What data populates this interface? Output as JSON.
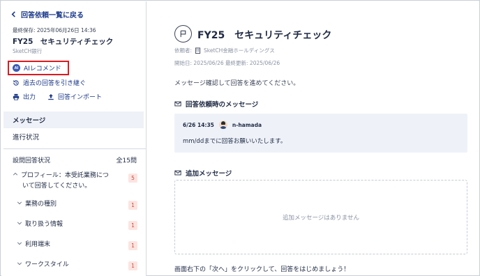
{
  "sidebar": {
    "back_label": "回答依頼一覧に戻る",
    "last_saved": "最終保存: 2025年06月26日 14:36",
    "title": "FY25　セキュリティチェック",
    "org": "SketCH銀行",
    "ai_recommend_label": "AIレコメンド",
    "ai_badge": "AI",
    "actions": {
      "inherit_label": "過去の回答を引き継ぐ",
      "export_label": "出力",
      "import_label": "回答インポート"
    },
    "nav": {
      "messages_label": "メッセージ",
      "progress_label": "進行状況"
    },
    "question_status": {
      "label": "設問回答状況",
      "total": "全15問"
    },
    "tree": [
      {
        "label_line1": "プロフィール：本受託業務につ",
        "label_line2": "いて回答してください。",
        "count": "5"
      },
      {
        "label": "業務の種別",
        "count": "1"
      },
      {
        "label": "取り扱う情報",
        "count": "1"
      },
      {
        "label": "利用端末",
        "count": "1"
      },
      {
        "label": "ワークスタイル",
        "count": "1"
      }
    ]
  },
  "main": {
    "title": "FY25　セキュリティチェック",
    "requester_label": "依頼者:",
    "requester_org": "SketCH金融ホールディングス",
    "dates": "開始日: 2025/06/26 最終更新: 2025/06/26",
    "intro": "メッセージ確認して回答を進めてください。",
    "request_message_heading": "回答依頼時のメッセージ",
    "message": {
      "time": "6/26 14:35",
      "author": "n-hamada",
      "text": "mm/ddまでに回答お願いいたします。"
    },
    "additional_heading": "追加メッセージ",
    "no_additional": "追加メッセージはありません",
    "footer": "画面右下の「次へ」をクリックして、回答をはじめましょう！"
  },
  "colors": {
    "accent": "#1d3a8a",
    "highlight_border": "#e0191f",
    "badge_bg": "#fde4e0",
    "badge_text": "#d0463a",
    "message_bg": "#eef2f8"
  }
}
